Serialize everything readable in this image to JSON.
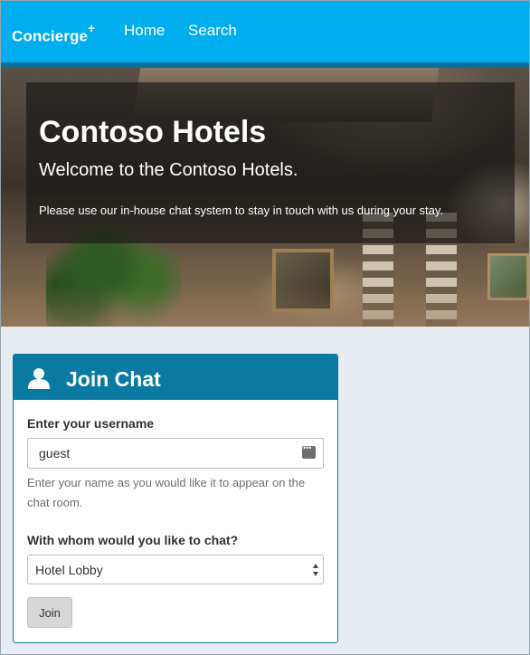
{
  "navbar": {
    "brand": "Concierge",
    "brand_sup": "+",
    "links": [
      {
        "label": "Home"
      },
      {
        "label": "Search"
      }
    ]
  },
  "hero": {
    "title": "Contoso Hotels",
    "subtitle": "Welcome to the Contoso Hotels.",
    "text": "Please use our in-house chat system to stay in touch with us during your stay."
  },
  "join_chat": {
    "title": "Join Chat",
    "header_icon": "user-icon",
    "username_label": "Enter your username",
    "username_value": "guest",
    "username_help": "Enter your name as you would like it to appear on the chat room.",
    "chat_with_label": "With whom would you like to chat?",
    "chat_with_selected": "Hotel Lobby",
    "join_button": "Join"
  },
  "colors": {
    "navbar": "#00adef",
    "panel_header": "#0a7aa3",
    "page_background": "#e6ecf2"
  }
}
